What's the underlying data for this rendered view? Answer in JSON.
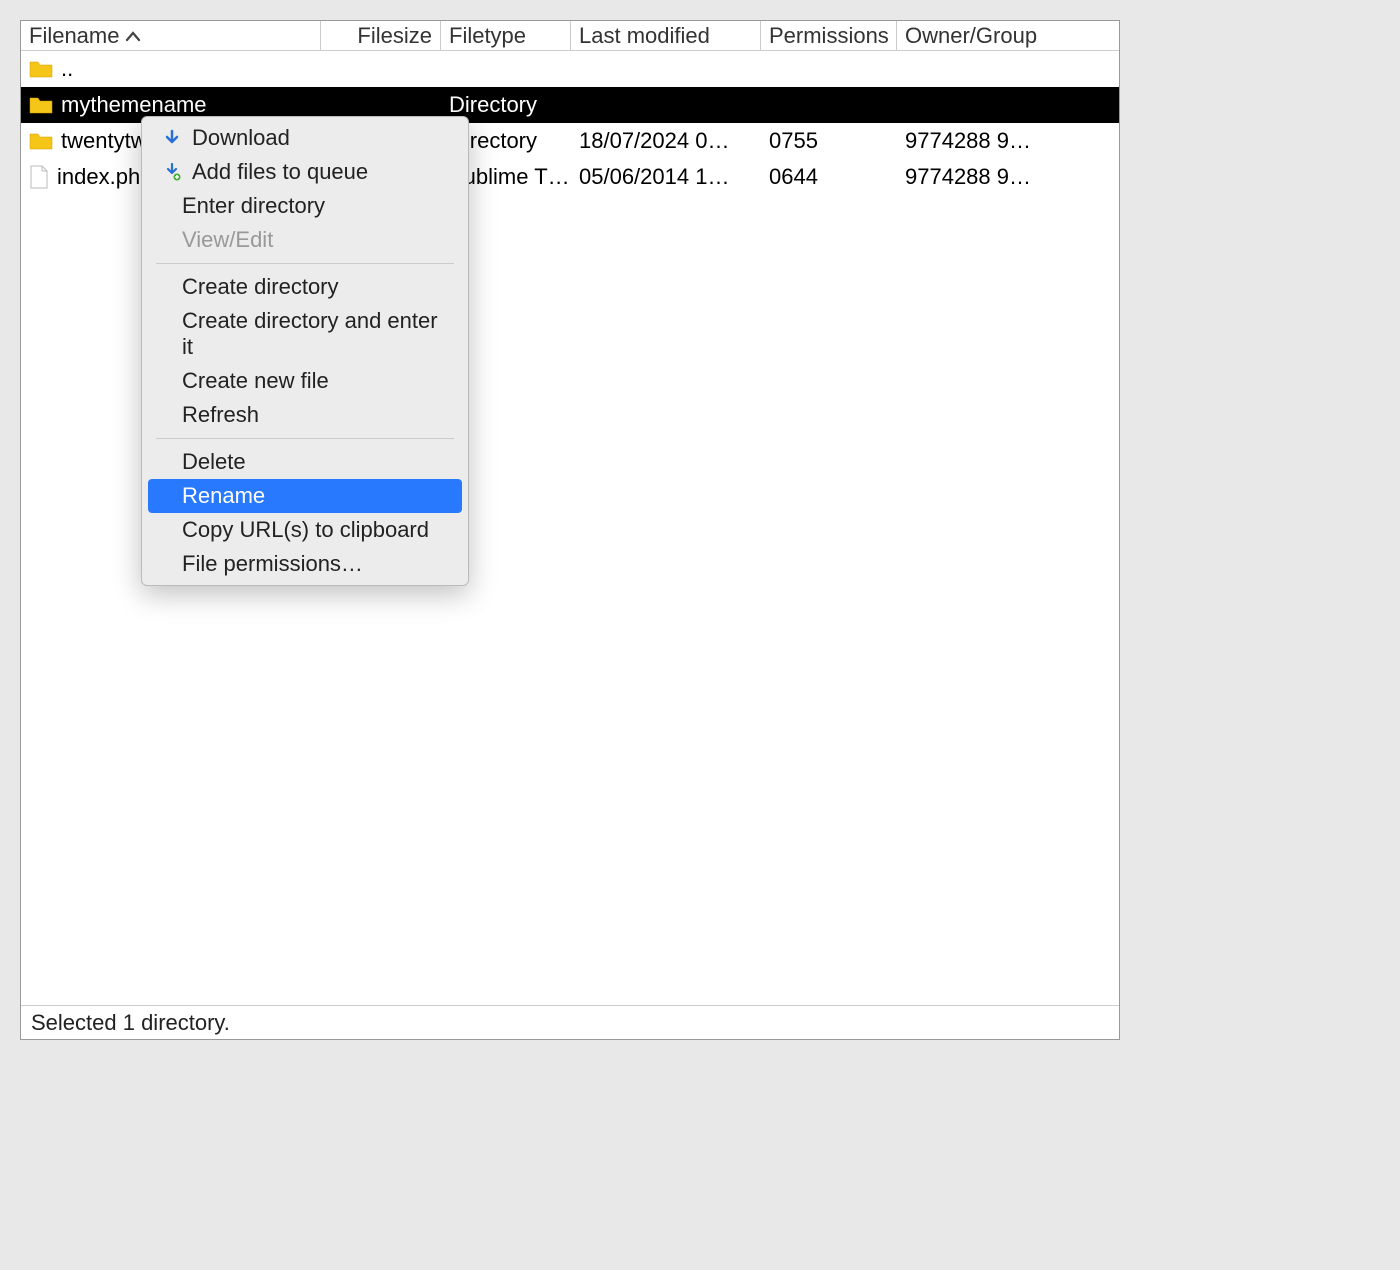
{
  "columns": {
    "filename": "Filename",
    "filesize": "Filesize",
    "filetype": "Filetype",
    "last_modified": "Last modified",
    "permissions": "Permissions",
    "owner_group": "Owner/Group"
  },
  "rows": [
    {
      "name": "..",
      "size": "",
      "type": "",
      "modified": "",
      "permissions": "",
      "owner": "",
      "icon": "folder",
      "selected": false
    },
    {
      "name": "mythemename",
      "size": "",
      "type": "Directory",
      "modified": "",
      "permissions": "",
      "owner": "",
      "icon": "folder",
      "selected": true
    },
    {
      "name": "twentytwentyfour",
      "size": "",
      "type": "Directory",
      "modified": "18/07/2024 0…",
      "permissions": "0755",
      "owner": "9774288 9…",
      "icon": "folder",
      "selected": false
    },
    {
      "name": "index.php",
      "size": "",
      "type": "Sublime T…",
      "modified": "05/06/2014 1…",
      "permissions": "0644",
      "owner": "9774288 9…",
      "icon": "file",
      "selected": false
    }
  ],
  "context_menu": {
    "download": "Download",
    "add_queue": "Add files to queue",
    "enter_directory": "Enter directory",
    "view_edit": "View/Edit",
    "create_directory": "Create directory",
    "create_directory_enter": "Create directory and enter it",
    "create_new_file": "Create new file",
    "refresh": "Refresh",
    "delete": "Delete",
    "rename": "Rename",
    "copy_urls": "Copy URL(s) to clipboard",
    "file_permissions": "File permissions…"
  },
  "status_bar": "Selected 1 directory."
}
